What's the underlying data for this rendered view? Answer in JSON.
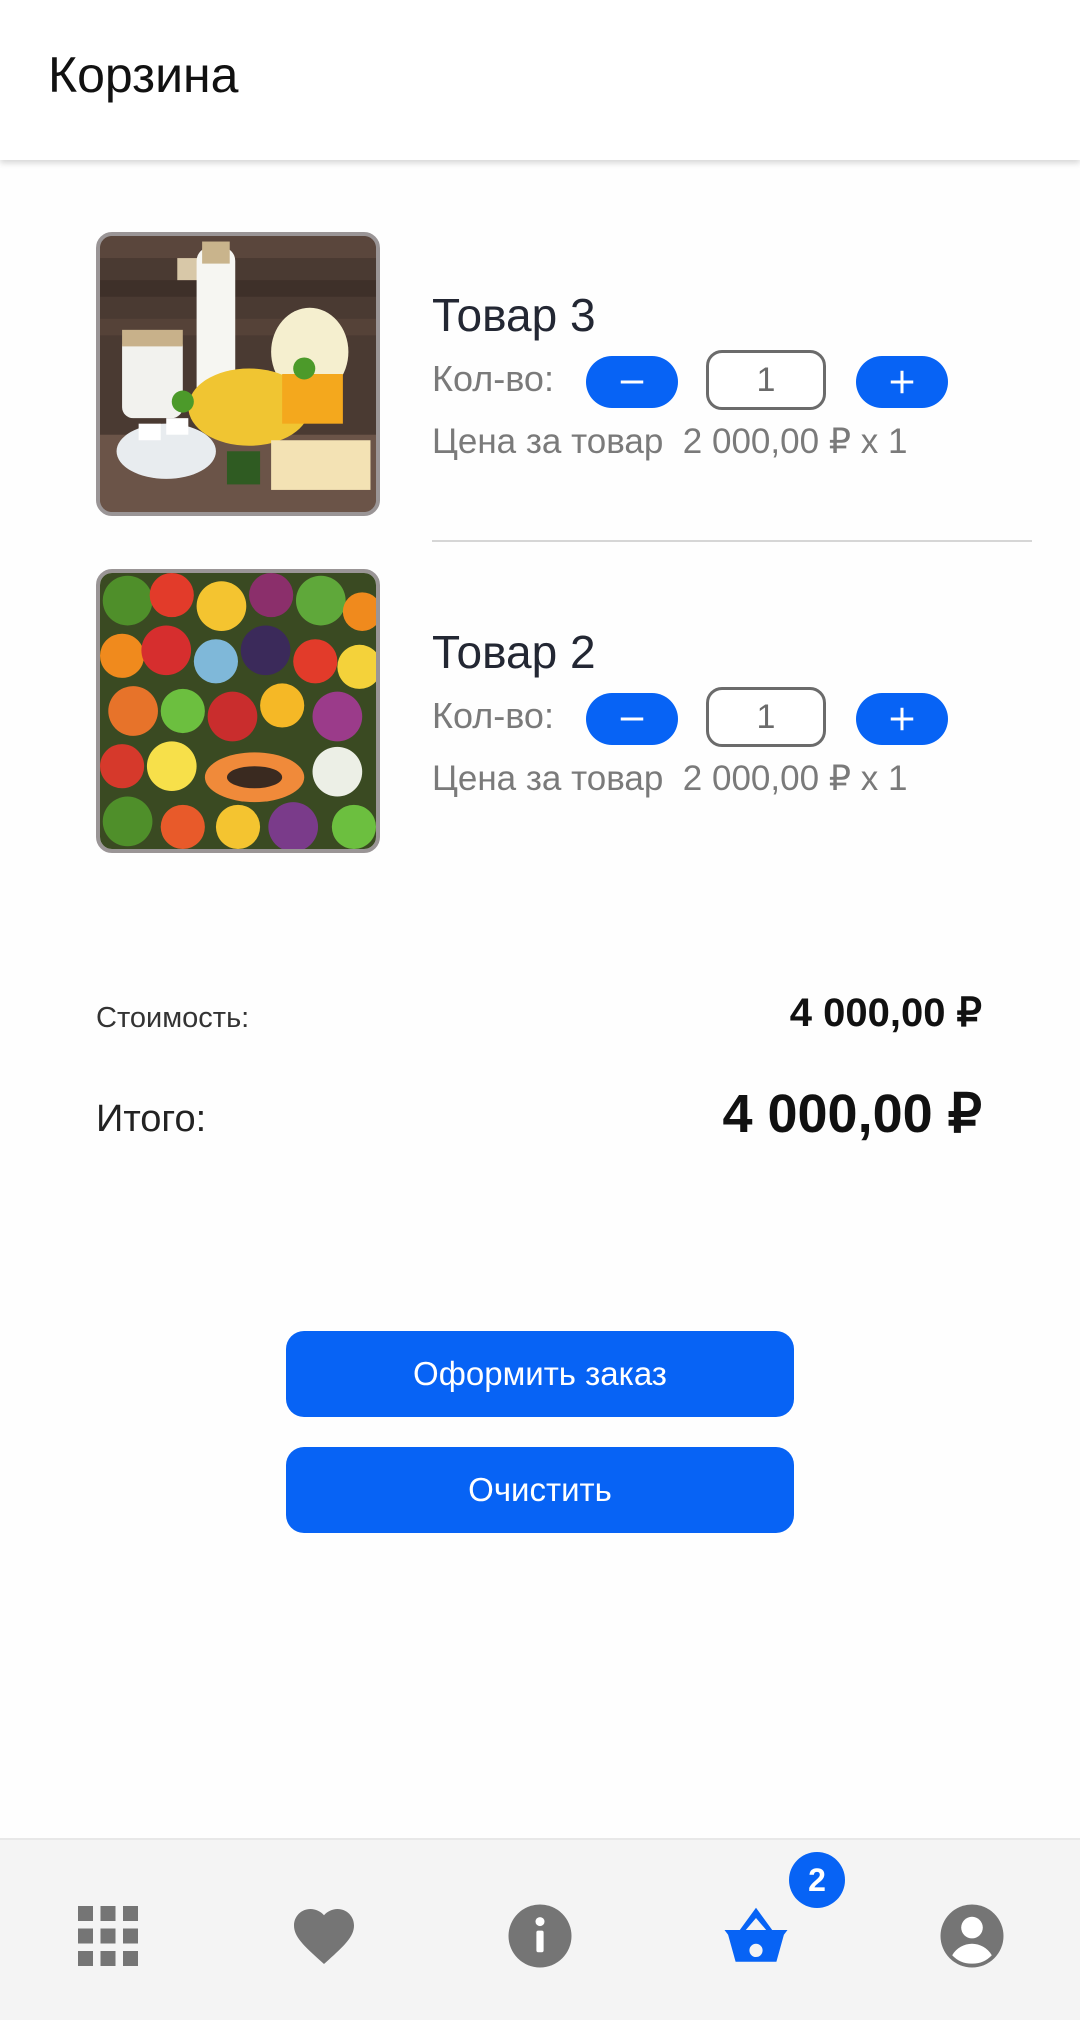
{
  "header": {
    "title": "Корзина"
  },
  "cart": {
    "items": [
      {
        "name": "Товар 3",
        "qty_label": "Кол-во:",
        "qty": "1",
        "price_line": "Цена за товар  2 000,00 ₽ x 1",
        "image": "dairy-products-photo"
      },
      {
        "name": "Товар 2",
        "qty_label": "Кол-во:",
        "qty": "1",
        "price_line": "Цена за товар  2 000,00 ₽ x 1",
        "image": "vegetables-photo"
      }
    ]
  },
  "summary": {
    "cost_label": "Стоимость:",
    "cost_value": "4 000,00 ₽",
    "total_label": "Итого:",
    "total_value": "4 000,00 ₽"
  },
  "actions": {
    "order_label": "Оформить заказ",
    "clear_label": "Очистить"
  },
  "bottom_nav": {
    "items": [
      "grid-icon",
      "heart-icon",
      "info-icon",
      "basket-icon",
      "account-icon"
    ],
    "active": "basket-icon",
    "cart_badge": "2"
  },
  "colors": {
    "accent": "#0763f5",
    "icon_gray": "#757575",
    "text_gray": "#7a7a7a"
  }
}
